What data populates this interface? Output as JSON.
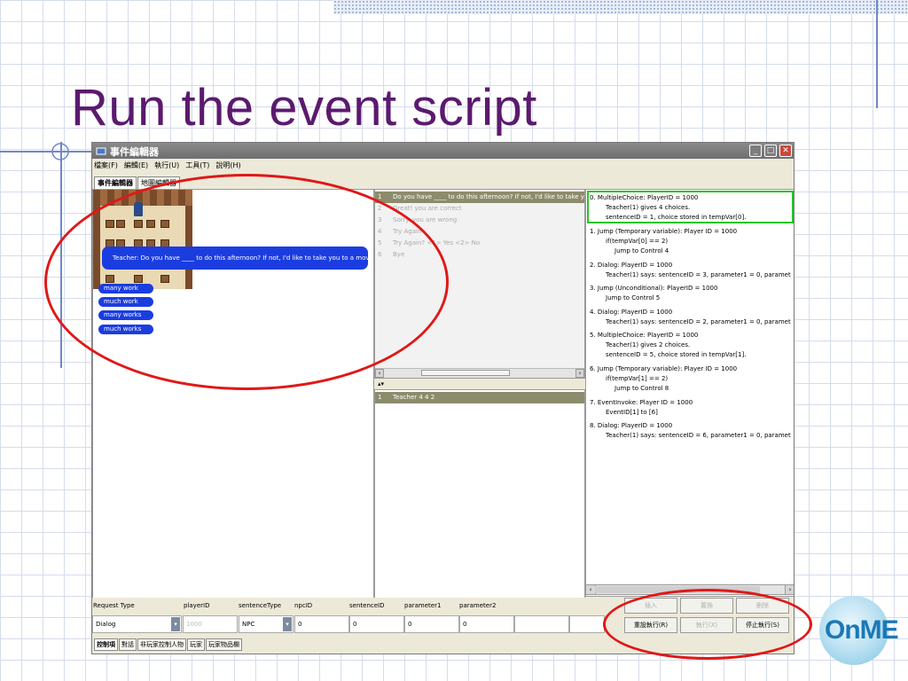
{
  "slide": {
    "title": "Run the event script",
    "logo_text": "OnME"
  },
  "window": {
    "title": "事件編輯器",
    "menu": [
      "檔案(F)",
      "編輯(E)",
      "執行(U)",
      "工具(T)",
      "說明(H)"
    ],
    "tabs": [
      "事件編輯器",
      "地圖編輯器"
    ]
  },
  "game": {
    "dialog_text": "Teacher: Do you have ____ to do this afternoon? If not, I'd like to take you to a movie.",
    "choices": [
      "many work",
      "much work",
      "many works",
      "much works"
    ]
  },
  "sentence_list": {
    "rows": [
      {
        "num": "1",
        "text": "Do you have ____ to do this afternoon? If not, I'd like to take you"
      },
      {
        "num": "2",
        "text": "Great! you are correct"
      },
      {
        "num": "3",
        "text": "Sorry. you are wrong"
      },
      {
        "num": "4",
        "text": "Try Again"
      },
      {
        "num": "5",
        "text": "Try Again? <1> Yes <2> No"
      },
      {
        "num": "6",
        "text": "Bye"
      }
    ]
  },
  "npc_list": {
    "rows": [
      {
        "num": "1",
        "text": "Teacher   4   4   2"
      }
    ]
  },
  "script": [
    {
      "lines": [
        "0.  MultipleChoice: PlayerID = 1000",
        "Teacher(1) gives 4 choices.",
        "sentenceID = 1, choice stored in tempVar[0]."
      ]
    },
    {
      "lines": [
        "1.  Jump (Temporary variable): Player ID = 1000",
        "if(tempVar[0] == 2)",
        "Jump to Control 4"
      ]
    },
    {
      "lines": [
        "2.  Dialog: PlayerID = 1000",
        "Teacher(1) says: sentenceID = 3, parameter1 = 0, paramet"
      ]
    },
    {
      "lines": [
        "3.  Jump (Unconditional): PlayerID = 1000",
        "Jump to Control 5"
      ]
    },
    {
      "lines": [
        "4.  Dialog: PlayerID = 1000",
        "Teacher(1) says: sentenceID = 2, parameter1 = 0, paramet"
      ]
    },
    {
      "lines": [
        "5.  MultipleChoice: PlayerID = 1000",
        "Teacher(1) gives 2 choices.",
        "sentenceID = 5, choice stored in tempVar[1]."
      ]
    },
    {
      "lines": [
        "6.  Jump (Temporary variable): Player ID = 1000",
        "if(tempVar[1] == 2)",
        "Jump to Control 8"
      ]
    },
    {
      "lines": [
        "7.  EventInvoke: Player ID = 1000",
        "EventID[1] to [6]"
      ]
    },
    {
      "lines": [
        "8.  Dialog: PlayerID = 1000",
        "Teacher(1) says: sentenceID = 6, parameter1 = 0, paramet"
      ]
    }
  ],
  "request": {
    "headers": [
      "Request Type",
      "playerID",
      "sentenceType",
      "npcID",
      "sentenceID",
      "parameter1",
      "parameter2"
    ],
    "values": {
      "request_type": "Dialog",
      "player_id": "1000",
      "sentence_type": "NPC",
      "npc_id": "0",
      "sentence_id": "0",
      "parameter1": "0",
      "parameter2": "0"
    }
  },
  "buttons": {
    "insert": "插入",
    "replace": "置換",
    "delete": "刪除",
    "run_section": "重設執行(R)",
    "run": "執行(X)",
    "stop": "停止執行(S)"
  },
  "bottom_tabs": [
    "控制項",
    "對話",
    "非玩家控制人物",
    "玩家",
    "玩家物品欄"
  ],
  "colors": {
    "title": "#5b1a6e",
    "annotation": "#e01818",
    "dialog_bubble": "#1b3de0",
    "selection": "#25c425"
  }
}
